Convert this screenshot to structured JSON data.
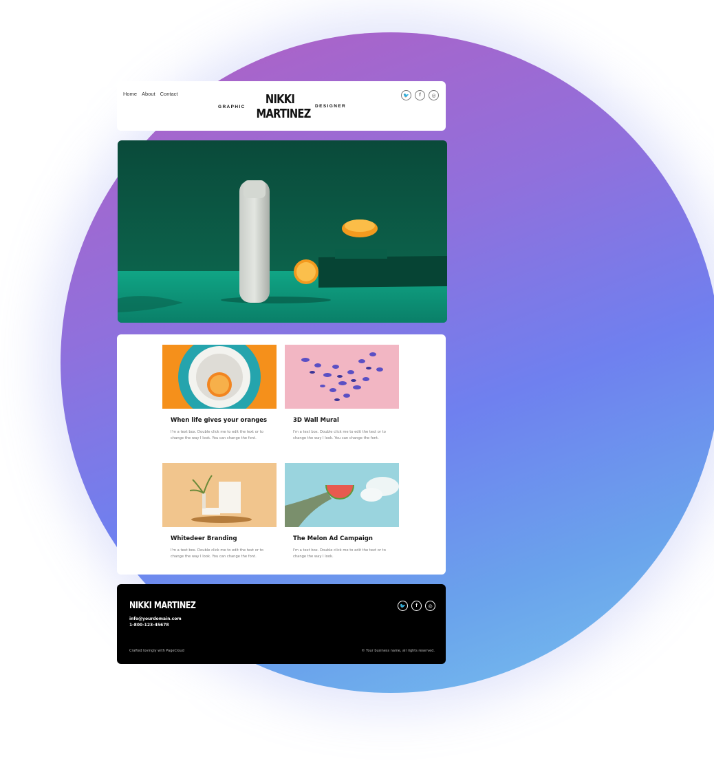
{
  "nav": {
    "items": [
      "Home",
      "About",
      "Contact"
    ]
  },
  "header": {
    "left_word": "GRAPHIC",
    "logo_line1": "NIKKI",
    "logo_line2": "MARTINEZ",
    "right_word": "DESIGNER"
  },
  "social": {
    "icons": [
      "twitter-icon",
      "facebook-icon",
      "instagram-icon"
    ],
    "glyphs": [
      "🐦",
      "f",
      "◎"
    ]
  },
  "portfolio": {
    "items": [
      {
        "title": "When life gives your oranges",
        "description": "I'm a text box. Double click me to edit the text or to change the way I look. You can change the font."
      },
      {
        "title": "3D Wall Mural",
        "description": "I'm a text box. Double click me to edit the text or to change the way I look. You can change the font."
      },
      {
        "title": "Whitedeer Branding",
        "description": "I'm a text box. Double click me to edit the text or to change the way I look. You can change the font."
      },
      {
        "title": "The Melon Ad Campaign",
        "description": "I'm a text box. Double click me to edit the text or to change the way I look."
      }
    ]
  },
  "footer": {
    "name": "NIKKI MARTINEZ",
    "email": "info@yourdomain.com",
    "phone": "1-800-123-45678",
    "credit": "Crafted lovingly with PageCloud",
    "copyright": "© Your business name, all rights reserved."
  },
  "colors": {
    "gradient_top": "#b35fc2",
    "gradient_bottom": "#78c4ee",
    "hero_green": "#0b5c48",
    "footer_bg": "#000000"
  }
}
